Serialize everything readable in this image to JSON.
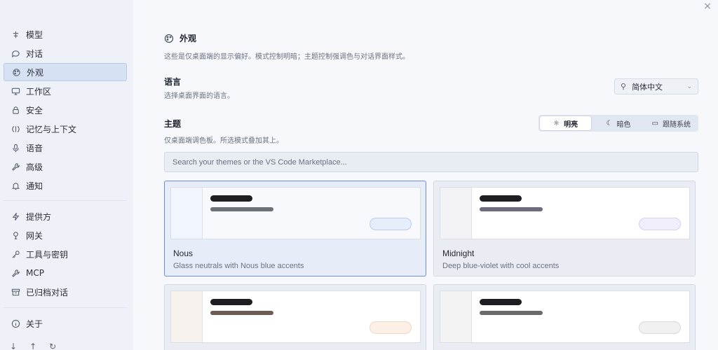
{
  "window": {
    "close": "×"
  },
  "sidebar": {
    "items": [
      {
        "label": "模型",
        "icon": "model-icon"
      },
      {
        "label": "对话",
        "icon": "chat-icon"
      },
      {
        "label": "外观",
        "icon": "palette-icon",
        "active": true
      },
      {
        "label": "工作区",
        "icon": "monitor-icon"
      },
      {
        "label": "安全",
        "icon": "lock-icon"
      },
      {
        "label": "记忆与上下文",
        "icon": "brain-icon"
      },
      {
        "label": "语音",
        "icon": "mic-icon"
      },
      {
        "label": "高级",
        "icon": "wrench-icon"
      },
      {
        "label": "通知",
        "icon": "bell-icon"
      }
    ],
    "items2": [
      {
        "label": "提供方",
        "icon": "bolt-icon"
      },
      {
        "label": "网关",
        "icon": "gateway-icon"
      },
      {
        "label": "工具与密钥",
        "icon": "key-icon"
      },
      {
        "label": "MCP",
        "icon": "wrench-icon"
      },
      {
        "label": "已归档对话",
        "icon": "archive-icon"
      }
    ],
    "about": {
      "label": "关于",
      "icon": "info-icon"
    }
  },
  "appearance": {
    "title": "外观",
    "description": "这些是仅桌面端的显示偏好。模式控制明暗；主题控制强调色与对话界面样式。"
  },
  "language": {
    "label": "语言",
    "description": "选择桌面界面的语言。",
    "value": "简体中文"
  },
  "theme": {
    "label": "主题",
    "description": "仅桌面端调色板。所选模式叠加其上。",
    "modes": [
      {
        "label": "明亮",
        "icon": "sun-icon",
        "active": true
      },
      {
        "label": "暗色",
        "icon": "moon-icon"
      },
      {
        "label": "跟随系统",
        "icon": "monitor-icon"
      }
    ],
    "search_placeholder": "Search your themes or the VS Code Marketplace...",
    "cards": [
      {
        "name": "Nous",
        "description": "Glass neutrals with Nous blue accents",
        "selected": true,
        "colors": {
          "side": "#f1f5fd",
          "content": "#f7f9fd",
          "bar2": "#6b7079",
          "pill_bg": "#e6eefb",
          "pill_border": "#b9cdf0"
        }
      },
      {
        "name": "Midnight",
        "description": "Deep blue-violet with cool accents",
        "colors": {
          "side": "#f2f2f7",
          "content": "#ffffff",
          "bar2": "#6e6b7c",
          "pill_bg": "#f1eefb",
          "pill_border": "#d7d2ee"
        }
      },
      {
        "name": "",
        "description": "",
        "colors": {
          "side": "#f8f2ee",
          "content": "#ffffff",
          "bar2": "#6e5c55",
          "pill_bg": "#fbefe6",
          "pill_border": "#f0d8c6"
        }
      },
      {
        "name": "",
        "description": "",
        "colors": {
          "side": "#f3f3f3",
          "content": "#ffffff",
          "bar2": "#6a6a6a",
          "pill_bg": "#f1f1f1",
          "pill_border": "#d9d9d9"
        }
      }
    ]
  }
}
